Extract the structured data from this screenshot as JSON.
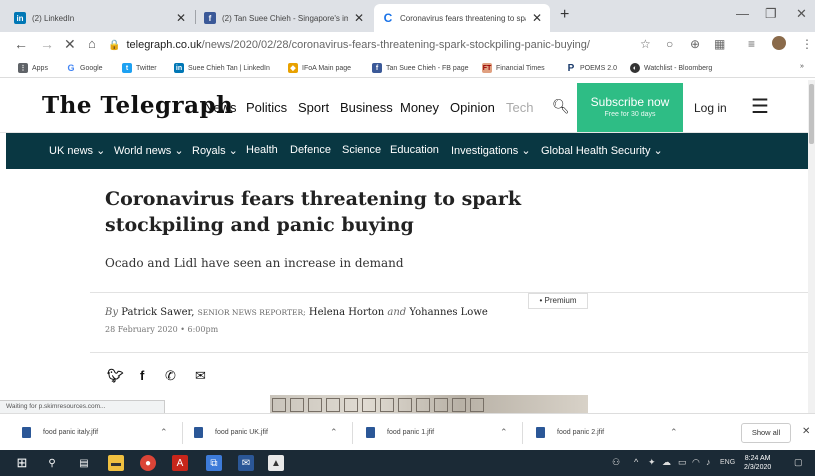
{
  "browser": {
    "tabs": [
      {
        "title": "(2) LinkedIn",
        "active": false,
        "favicon": "linkedin-icon"
      },
      {
        "title": "(2) Tan Suee Chieh - Singapore's impre",
        "active": false,
        "favicon": "facebook-icon"
      },
      {
        "title": "Coronavirus fears threatening to spark",
        "active": true,
        "favicon": "loading-spinner-icon"
      }
    ],
    "new_tab": "+",
    "url_host": "telegraph.co.uk",
    "url_path": "/news/2020/02/28/coronavirus-fears-threatening-spark-stockpiling-panic-buying/",
    "bookmarks": [
      {
        "label": "Apps",
        "icon": "apps-grid-icon",
        "color": "#5f6368"
      },
      {
        "label": "Google",
        "icon": "google-icon",
        "color": "#4285f4"
      },
      {
        "label": "Twitter",
        "icon": "twitter-icon",
        "color": "#1da1f2"
      },
      {
        "label": "Suee Chieh Tan | LinkedIn",
        "icon": "linkedin-icon",
        "color": "#0077b5"
      },
      {
        "label": "IFoA Main page",
        "icon": "ifoa-icon",
        "color": "#e8a100"
      },
      {
        "label": "Tan Suee Chieh - FB page",
        "icon": "facebook-icon",
        "color": "#3b5998"
      },
      {
        "label": "Financial Times",
        "icon": "ft-icon",
        "color": "#e0a080"
      },
      {
        "label": "POEMS 2.0",
        "icon": "poems-icon",
        "color": "#1a3a6b"
      },
      {
        "label": "Watchlist - Bloomberg",
        "icon": "bloomberg-icon",
        "color": "#333333"
      }
    ],
    "status_text": "Waiting for p.skimresources.com..."
  },
  "site": {
    "logo": "The Telegraph",
    "nav": [
      "News",
      "Politics",
      "Sport",
      "Business",
      "Money",
      "Opinion",
      "Tech"
    ],
    "subscribe_title": "Subscribe now",
    "subscribe_sub": "Free for 30 days",
    "login": "Log in",
    "sections": [
      "UK news ⌄",
      "World news ⌄",
      "Royals ⌄",
      "Health",
      "Defence",
      "Science",
      "Education",
      "Investigations ⌄",
      "Global Health Security ⌄"
    ],
    "brand_color": "#093742",
    "subscribe_color": "#2ebd85"
  },
  "article": {
    "headline": "Coronavirus fears threatening to spark stockpiling and panic buying",
    "standfirst": "Ocado and Lidl have seen an increase in demand",
    "premium": "• Premium",
    "by": "By",
    "author1": "Patrick Sawer,",
    "author1_role": "SENIOR NEWS REPORTER;",
    "author2": "Helena Horton",
    "and": "and",
    "author3": "Yohannes Lowe",
    "date": "28 February 2020 • 6:00pm"
  },
  "downloads": {
    "items": [
      "food panic italy.jfif",
      "food panic UK.jfif",
      "food panic 1.jfif",
      "food panic 2.jfif"
    ],
    "show_all": "Show all"
  },
  "taskbar": {
    "time": "8:24 AM",
    "date": "2/3/2020",
    "lang": "ENG"
  }
}
